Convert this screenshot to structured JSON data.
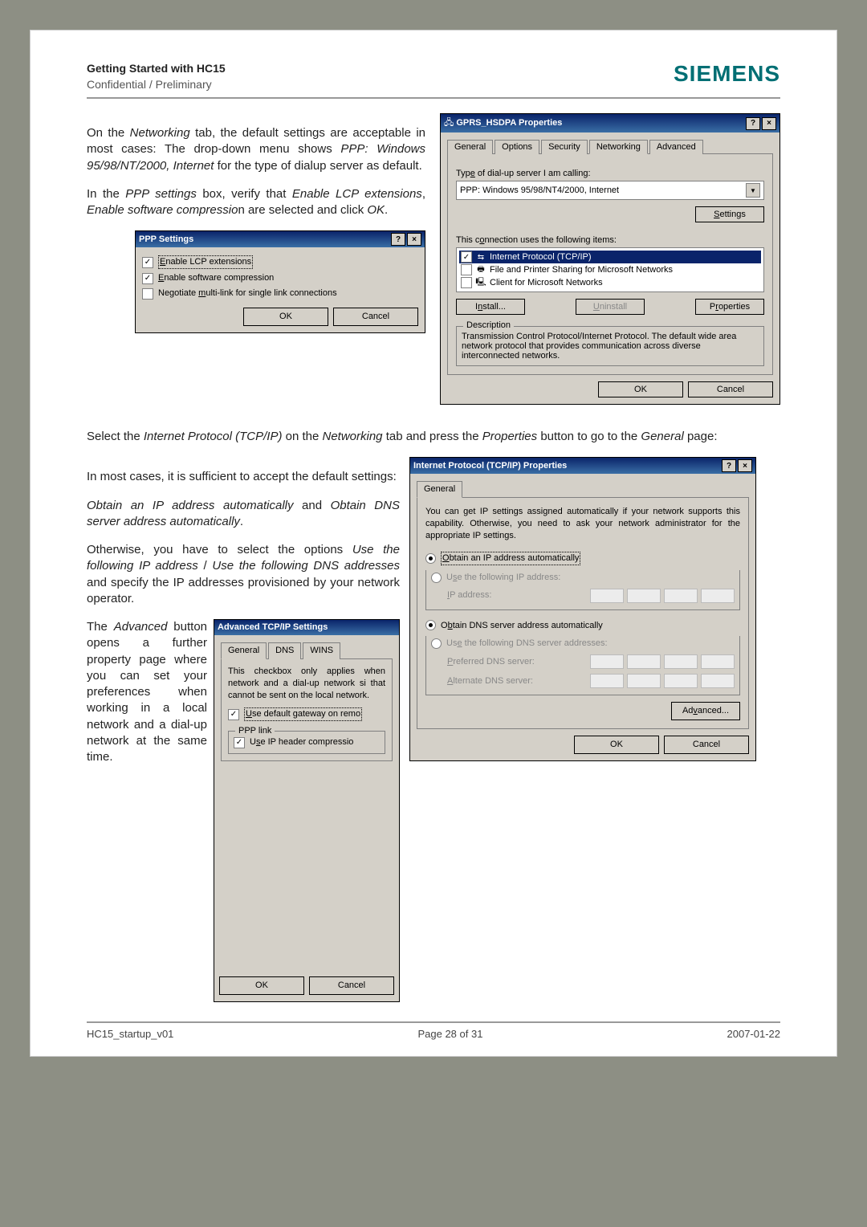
{
  "header": {
    "title": "Getting Started with HC15",
    "subtitle": "Confidential / Preliminary",
    "brand": "SIEMENS"
  },
  "para1_a": "On the ",
  "para1_b": "Networking",
  "para1_c": " tab, the default settings are acceptable in most cases: The drop-down menu shows ",
  "para1_d": "PPP: Windows 95/98/NT/2000, Internet",
  "para1_e": " for the type of dialup server as default.",
  "para2_a": "In the ",
  "para2_b": "PPP settings",
  "para2_c": " box, verify that ",
  "para2_d": "Enable LCP extensions",
  "para2_e": ", ",
  "para2_f": "Enable software compressio",
  "para2_g": "n are selected and click ",
  "para2_h": "OK",
  "para2_i": ".",
  "gprs_dlg": {
    "title": "GPRS_HSDPA Properties",
    "tabs": [
      "General",
      "Options",
      "Security",
      "Networking",
      "Advanced"
    ],
    "active_tab": "Networking",
    "type_label": "Type of dial-up server I am calling:",
    "type_value": "PPP: Windows 95/98/NT4/2000, Internet",
    "settings_btn": "Settings",
    "conn_label": "This connection uses the following items:",
    "items": [
      {
        "check": "✓",
        "icon": "⇆",
        "text": "Internet Protocol (TCP/IP)",
        "selected": true
      },
      {
        "check": "",
        "icon": "🖶",
        "text": "File and Printer Sharing for Microsoft Networks",
        "selected": false
      },
      {
        "check": "",
        "icon": "🖳",
        "text": "Client for Microsoft Networks",
        "selected": false
      }
    ],
    "install": "Install...",
    "uninstall": "Uninstall",
    "properties": "Properties",
    "desc_title": "Description",
    "desc_text": "Transmission Control Protocol/Internet Protocol. The default wide area network protocol that provides communication across diverse interconnected networks.",
    "ok": "OK",
    "cancel": "Cancel"
  },
  "ppp_dlg": {
    "title": "PPP Settings",
    "opt1": "Enable LCP extensions",
    "opt2": "Enable software compression",
    "opt3": "Negotiate multi-link for single link connections",
    "ok": "OK",
    "cancel": "Cancel"
  },
  "para3_a": "Select the ",
  "para3_b": "Internet Protocol (TCP/IP)",
  "para3_c": " on the ",
  "para3_d": "Networking",
  "para3_e": " tab and press the ",
  "para3_f": "Properties",
  "para3_g": " button to go to the ",
  "para3_h": "General",
  "para3_i": " page:",
  "para4": "In most cases, it is sufficient to accept the default settings:",
  "para5_a": "Obtain an IP address automatically",
  "para5_b": " and ",
  "para5_c": "Obtain DNS server address automatically",
  "para5_d": ".",
  "para6_a": "Otherwise, you have to select the options ",
  "para6_b": "Use the following IP address",
  "para6_c": " / ",
  "para6_d": "Use the following DNS addresses",
  "para6_e": " and specify the IP addresses provisioned by your network operator.",
  "para7_a": "The ",
  "para7_b": "Advanced",
  "para7_c": " button opens a further property page where you can set your preferences when working in a local network and a dial-up network at the same time.",
  "tcpip_dlg": {
    "title": "Internet Protocol (TCP/IP) Properties",
    "tab": "General",
    "intro": "You can get IP settings assigned automatically if your network supports this capability. Otherwise, you need to ask your network administrator for the appropriate IP settings.",
    "r1": "Obtain an IP address automatically",
    "r2": "Use the following IP address:",
    "ip_label": "IP address:",
    "r3": "Obtain DNS server address automatically",
    "r4": "Use the following DNS server addresses:",
    "pref": "Preferred DNS server:",
    "alt": "Alternate DNS server:",
    "adv": "Advanced...",
    "ok": "OK",
    "cancel": "Cancel"
  },
  "adv_dlg": {
    "title": "Advanced TCP/IP Settings",
    "tabs": [
      "General",
      "DNS",
      "WINS"
    ],
    "intro": "This checkbox only applies when network and a dial-up network si that cannot be sent on the local network.",
    "c1": "Use default gateway on remo",
    "ppp_group": "PPP link",
    "c2": "Use IP header compressio",
    "ok": "OK",
    "cancel": "Cancel"
  },
  "footer": {
    "left": "HC15_startup_v01",
    "center": "Page 28 of 31",
    "right": "2007-01-22"
  }
}
